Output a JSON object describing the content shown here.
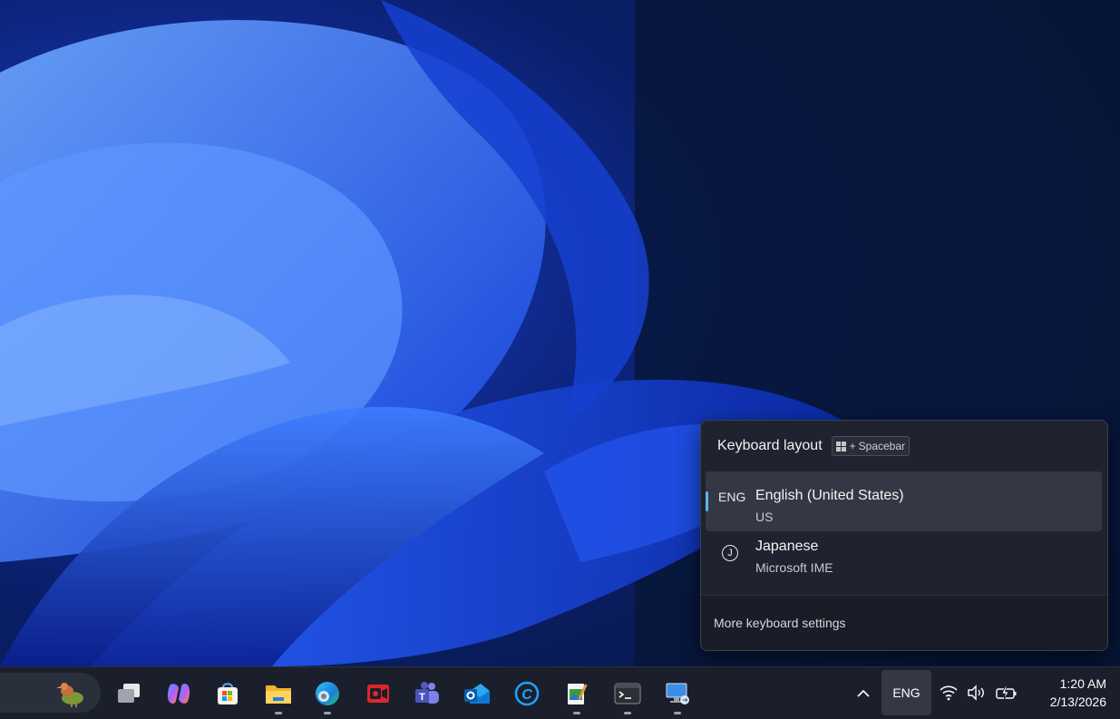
{
  "flyout": {
    "title": "Keyboard layout",
    "shortcut_plus": "+",
    "shortcut_key": "Spacebar",
    "items": [
      {
        "code": "ENG",
        "name": "English (United States)",
        "sub": "US",
        "selected": true
      },
      {
        "icon": "ime-circle-icon",
        "name": "Japanese",
        "sub": "Microsoft IME",
        "selected": false
      }
    ],
    "footer_link": "More keyboard settings"
  },
  "taskbar": {
    "apps": [
      "task-view-icon",
      "copilot-icon",
      "microsoft-store-icon",
      "file-explorer-icon",
      "edge-icon",
      "screen-recorder-icon",
      "teams-icon",
      "outlook-icon",
      "ccleaner-icon",
      "notepad-icon",
      "terminal-icon",
      "remote-desktop-icon"
    ],
    "language_indicator": "ENG",
    "time": "1:20 AM",
    "date": "2/13/2026"
  },
  "colors": {
    "accent": "#5fb2f2",
    "flyout_bg": "#1f2330",
    "taskbar_bg": "#1b1f2b"
  }
}
